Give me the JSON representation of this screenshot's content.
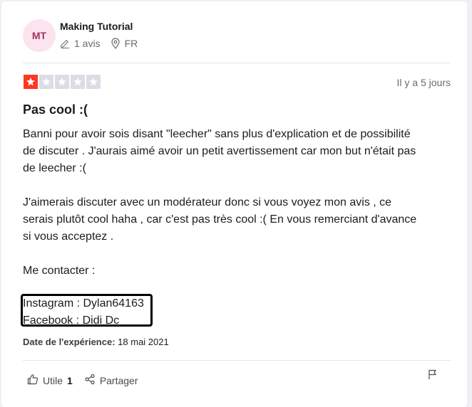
{
  "reviewer": {
    "initials": "MT",
    "name": "Making Tutorial",
    "review_count": "1 avis",
    "country": "FR"
  },
  "review": {
    "rating": 1,
    "rating_max": 5,
    "date": "Il y a 5 jours",
    "title": "Pas cool :(",
    "body_lines": [
      "Banni pour avoir sois disant \"leecher\" sans plus d'explication et de possibilité",
      "de discuter . J'aurais aimé avoir un petit avertissement car mon but n'était pas",
      "de leecher :(",
      "",
      "J'aimerais discuter avec un modérateur donc si vous voyez mon avis , ce",
      "serais plutôt cool haha , car c'est pas très cool :( En vous remerciant d'avance",
      "si vous acceptez .",
      "",
      "Me contacter :"
    ],
    "contact_instagram": "Instagram : Dylan64163",
    "contact_facebook": "Facebook : Didi Dc",
    "experience_label": "Date de l'expérience:",
    "experience_date": "18 mai 2021"
  },
  "actions": {
    "useful_label": "Utile",
    "useful_count": "1",
    "share_label": "Partager"
  },
  "colors": {
    "star_filled": "#ff3722",
    "star_empty": "#dcdce6",
    "avatar_bg": "#fbe4ee",
    "avatar_text": "#a1365f"
  }
}
